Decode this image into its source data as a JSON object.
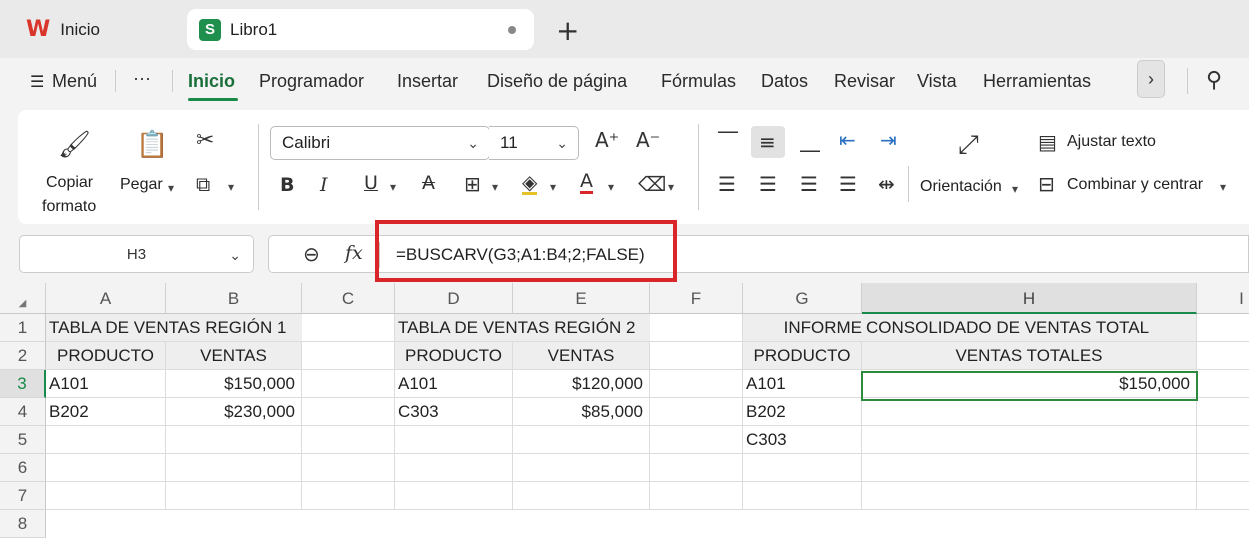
{
  "tabs": [
    {
      "label": "Inicio",
      "icon": "wps-logo-icon"
    },
    {
      "label": "Libro1",
      "icon": "spreadsheet-icon"
    }
  ],
  "menu": {
    "menu_label": "Menú",
    "more_label": "···",
    "items": [
      "Inicio",
      "Programador",
      "Insertar",
      "Diseño de página",
      "Fórmulas",
      "Datos",
      "Revisar",
      "Vista",
      "Herramientas"
    ],
    "active": "Inicio"
  },
  "ribbon": {
    "copy_format_1": "Copiar",
    "copy_format_2": "formato",
    "paste": "Pegar",
    "font_name": "Calibri",
    "font_size": "11",
    "orientation": "Orientación",
    "wrap_text": "Ajustar texto",
    "merge_center": "Combinar y centrar"
  },
  "formula_bar": {
    "cell_ref": "H3",
    "fx": "fx",
    "formula": "=BUSCARV(G3;A1:B4;2;FALSE)"
  },
  "colors": {
    "accent": "#1a8a4a",
    "highlight": "#d9262b"
  },
  "sheet": {
    "columns": [
      "A",
      "B",
      "C",
      "D",
      "E",
      "F",
      "G",
      "H",
      "I"
    ],
    "rows": [
      "1",
      "2",
      "3",
      "4",
      "5",
      "6",
      "7",
      "8"
    ],
    "selected_cell": "H3",
    "cells": {
      "A1": "TABLA DE VENTAS REGIÓN 1",
      "A2": "PRODUCTO",
      "B2": "VENTAS",
      "A3": "A101",
      "B3": "$150,000",
      "A4": "B202",
      "B4": "$230,000",
      "D1": "TABLA DE VENTAS REGIÓN 2",
      "D2": "PRODUCTO",
      "E2": "VENTAS",
      "D3": "A101",
      "E3": "$120,000",
      "D4": "C303",
      "E4": "$85,000",
      "G1": "INFORME CONSOLIDADO DE VENTAS TOTAL",
      "G2": "PRODUCTO",
      "H2": "VENTAS TOTALES",
      "G3": "A101",
      "H3": "$150,000",
      "G4": "B202",
      "G5": "C303"
    }
  }
}
